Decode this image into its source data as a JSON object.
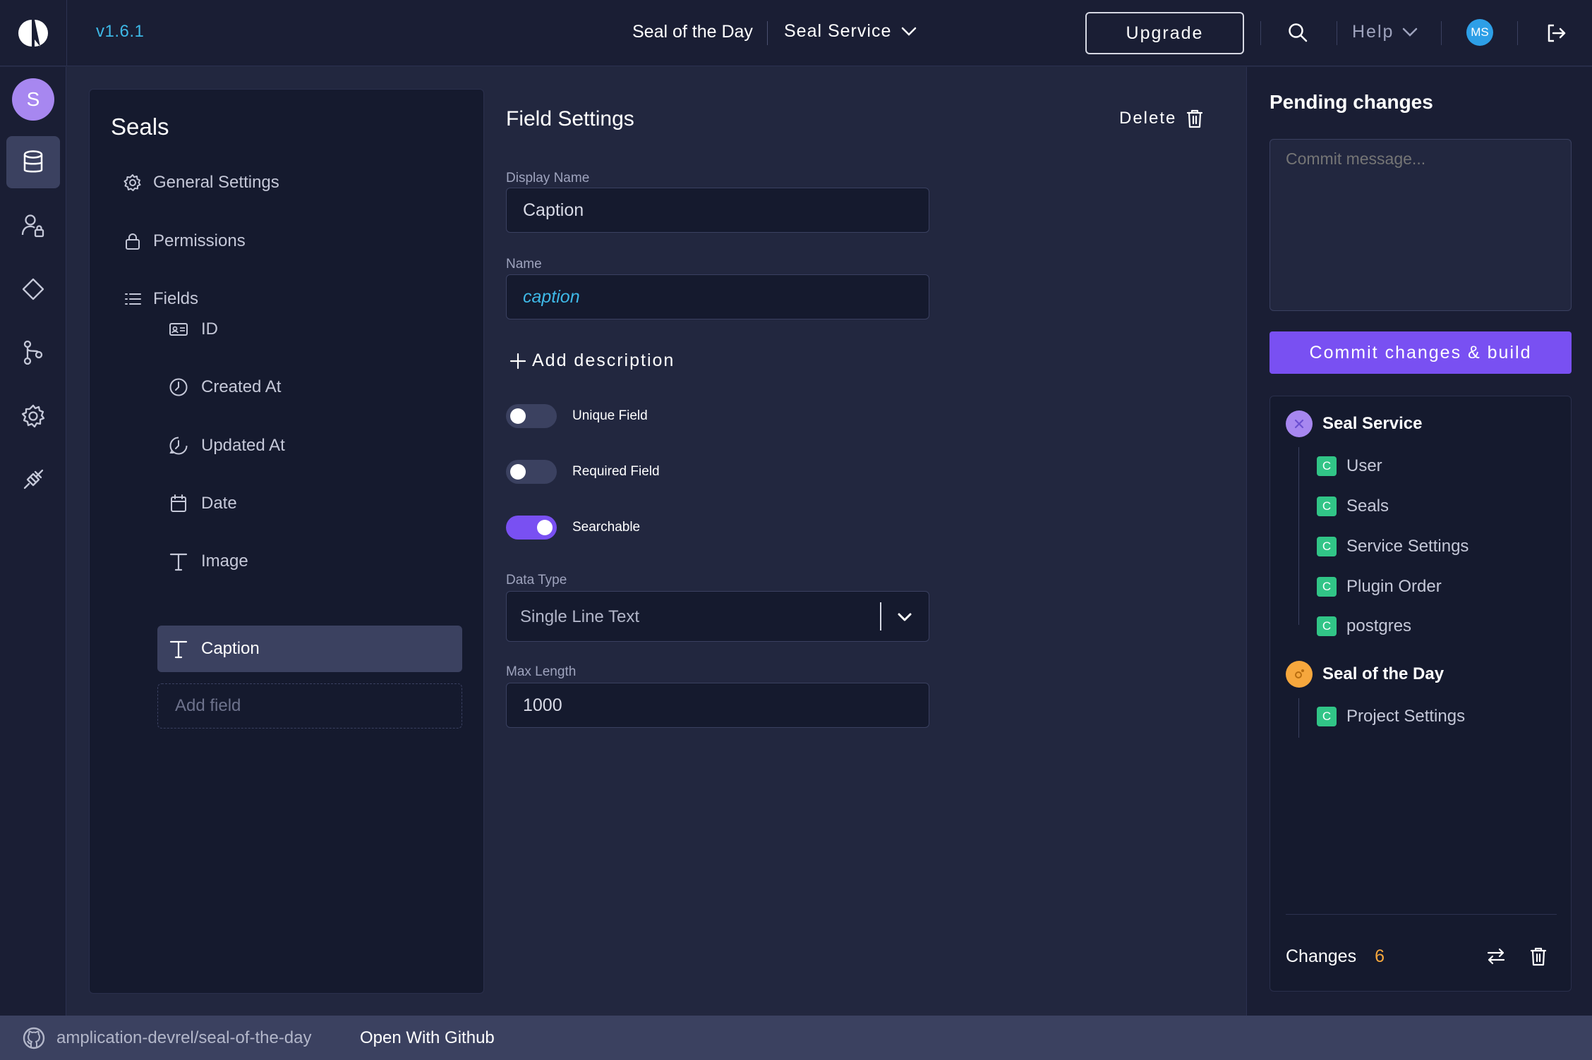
{
  "app": {
    "version": "v1.6.1"
  },
  "header": {
    "project_name": "Seal of the Day",
    "service_name": "Seal Service",
    "upgrade_label": "Upgrade",
    "help_label": "Help",
    "user_initials": "MS"
  },
  "rail": {
    "workspace_initial": "S",
    "items": [
      "database-icon",
      "user-lock-icon",
      "diamond-icon",
      "git-branch-icon",
      "gear-icon",
      "plugin-icon"
    ]
  },
  "entity_nav": {
    "title": "Seals",
    "general_settings": "General Settings",
    "permissions": "Permissions",
    "fields_label": "Fields",
    "fields": [
      {
        "label": "ID",
        "icon": "id-card-icon"
      },
      {
        "label": "Created At",
        "icon": "clock-icon"
      },
      {
        "label": "Updated At",
        "icon": "clock-refresh-icon"
      },
      {
        "label": "Date",
        "icon": "calendar-icon"
      },
      {
        "label": "Image",
        "icon": "text-icon"
      },
      {
        "label": "Caption",
        "icon": "text-icon",
        "selected": true
      }
    ],
    "add_field_placeholder": "Add field"
  },
  "field_settings": {
    "title": "Field Settings",
    "delete_label": "Delete",
    "display_name_label": "Display Name",
    "display_name_value": "Caption",
    "name_label": "Name",
    "name_value": "caption",
    "add_description_label": "Add description",
    "unique_label": "Unique Field",
    "unique_on": false,
    "required_label": "Required Field",
    "required_on": false,
    "searchable_label": "Searchable",
    "searchable_on": true,
    "data_type_label": "Data Type",
    "data_type_value": "Single Line Text",
    "max_length_label": "Max Length",
    "max_length_value": "1000"
  },
  "pending": {
    "title": "Pending changes",
    "commit_placeholder": "Commit message...",
    "commit_button": "Commit changes & build",
    "groups": [
      {
        "name": "Seal Service",
        "icon_color": "#a787f0",
        "items": [
          "User",
          "Seals",
          "Service Settings",
          "Plugin Order",
          "postgres"
        ]
      },
      {
        "name": "Seal of the Day",
        "icon_color": "#f6a73d",
        "items": [
          "Project Settings"
        ]
      }
    ],
    "change_badge": "C",
    "changes_label": "Changes",
    "changes_count": "6"
  },
  "footer": {
    "repo": "amplication-devrel/seal-of-the-day",
    "open_github": "Open With Github"
  },
  "colors": {
    "accent": "#7950f2",
    "link": "#3eb8e6",
    "change_badge": "#31c587",
    "count": "#f6a73d"
  }
}
